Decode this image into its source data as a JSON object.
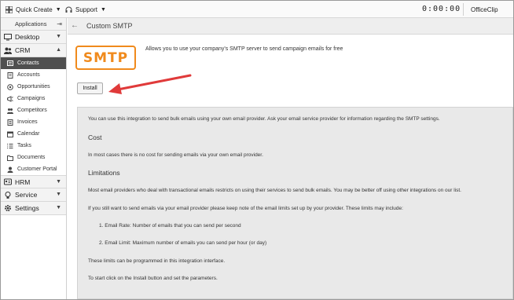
{
  "topbar": {
    "quick_create": "Quick Create",
    "support": "Support",
    "timer": "0:00:00",
    "brand": "OfficeClip"
  },
  "sidebar": {
    "applications_label": "Applications",
    "desktop": "Desktop",
    "crm": "CRM",
    "crm_items": [
      {
        "label": "Contacts",
        "icon": "contacts-icon"
      },
      {
        "label": "Accounts",
        "icon": "accounts-icon"
      },
      {
        "label": "Opportunities",
        "icon": "opportunities-icon"
      },
      {
        "label": "Campaigns",
        "icon": "campaigns-icon"
      },
      {
        "label": "Competitors",
        "icon": "competitors-icon"
      },
      {
        "label": "Invoices",
        "icon": "invoices-icon"
      },
      {
        "label": "Calendar",
        "icon": "calendar-icon"
      },
      {
        "label": "Tasks",
        "icon": "tasks-icon"
      },
      {
        "label": "Documents",
        "icon": "documents-icon"
      },
      {
        "label": "Customer Portal",
        "icon": "customer-portal-icon"
      }
    ],
    "hrm": "HRM",
    "service": "Service",
    "settings": "Settings"
  },
  "main": {
    "title": "Custom SMTP",
    "logo_text": "SMTP",
    "intro": "Allows you to use your company's SMTP server to send campaign emails for free",
    "install_label": "Install",
    "info": {
      "p1": "You can use this integration to send bulk emails using your own email provider. Ask your email service provider for information regarding the SMTP settings.",
      "cost_heading": "Cost",
      "cost_text": "In most cases there is no cost for sending emails via your own email provider.",
      "limitations_heading": "Limitations",
      "lim_p1": "Most email providers who deal with transactional emails restricts on using their services to send bulk emails. You may be better off using other integrations on our list.",
      "lim_p2": "If you still want to send emails via your email provider please keep note of the email limits set up by your provider. These limits may include:",
      "list1": "1. Email Rate: Number of emails that you can send per second",
      "list2": "2. Email Limit: Maximum number of emails you can send per hour (or day)",
      "lim_p3": "These limits can be programmed in this integration interface.",
      "lim_p4": "To start click on the Install button and set the parameters."
    }
  },
  "colors": {
    "accent_orange": "#f08a1c",
    "arrow_red": "#e03a3a",
    "active_item": "#4f4f4f"
  }
}
